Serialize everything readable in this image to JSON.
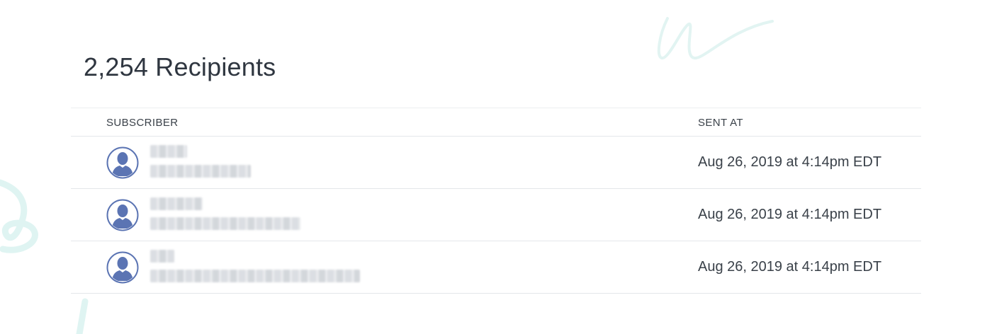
{
  "page": {
    "title": "2,254 Recipients"
  },
  "table": {
    "columns": {
      "subscriber": "SUBSCRIBER",
      "sent_at": "SENT AT"
    },
    "rows": [
      {
        "sent_at": "Aug 26, 2019 at 4:14pm EDT"
      },
      {
        "sent_at": "Aug 26, 2019 at 4:14pm EDT"
      },
      {
        "sent_at": "Aug 26, 2019 at 4:14pm EDT"
      }
    ]
  },
  "icons": {
    "avatar": "user-avatar-icon"
  },
  "colors": {
    "avatar": "#5b74b3",
    "decoration": "#dff4f2"
  }
}
